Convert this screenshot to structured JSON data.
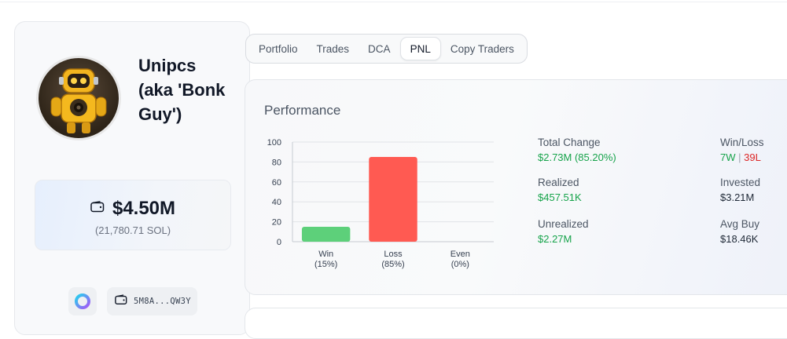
{
  "profile": {
    "name": "Unipcs (aka 'Bonk Guy')",
    "avatar_icon": "robot-avatar",
    "balance_usd": "$4.50M",
    "balance_sol": "(21,780.71 SOL)",
    "wallet_address": "5M8A...QW3Y"
  },
  "tabs": [
    {
      "label": "Portfolio",
      "active": false
    },
    {
      "label": "Trades",
      "active": false
    },
    {
      "label": "DCA",
      "active": false
    },
    {
      "label": "PNL",
      "active": true
    },
    {
      "label": "Copy Traders",
      "active": false
    }
  ],
  "performance": {
    "title": "Performance",
    "total_change_label": "Total Change",
    "total_change_value": "$2.73M (85.20%)",
    "realized_label": "Realized",
    "realized_value": "$457.51K",
    "unrealized_label": "Unrealized",
    "unrealized_value": "$2.27M",
    "winloss_label": "Win/Loss",
    "wins": "7W",
    "separator": "|",
    "losses": "39L",
    "invested_label": "Invested",
    "invested_value": "$3.21M",
    "avg_buy_label": "Avg Buy",
    "avg_buy_value": "$18.46K"
  },
  "colors": {
    "positive": "#16a34a",
    "negative": "#dc2626",
    "win_bar": "#5dd07a",
    "loss_bar": "#ff5a52"
  },
  "chart_data": {
    "type": "bar",
    "categories": [
      "Win",
      "Loss",
      "Even"
    ],
    "category_sublabels": [
      "(15%)",
      "(85%)",
      "(0%)"
    ],
    "values": [
      15,
      85,
      0
    ],
    "bar_colors": [
      "#5dd07a",
      "#ff5a52",
      "#9ca3af"
    ],
    "ylim": [
      0,
      100
    ],
    "yticks": [
      0,
      20,
      40,
      60,
      80,
      100
    ],
    "grid": true,
    "title": "",
    "xlabel": "",
    "ylabel": ""
  }
}
